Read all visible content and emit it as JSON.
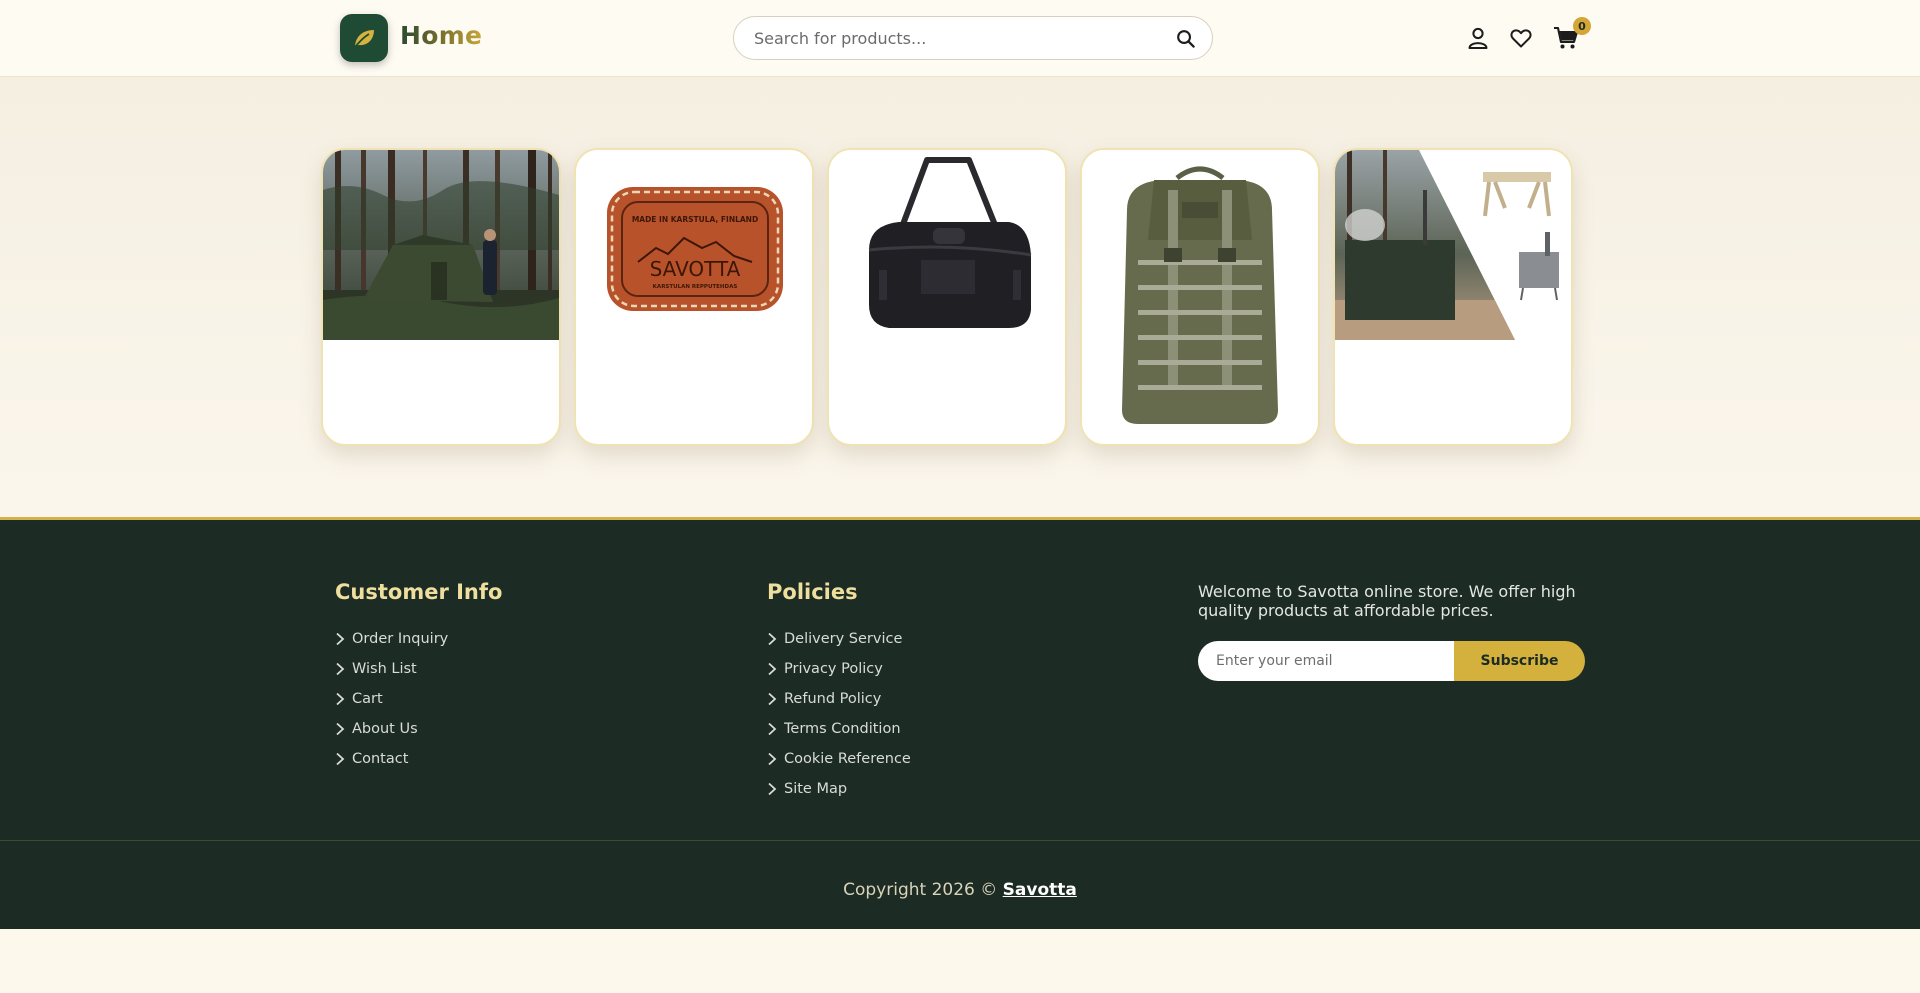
{
  "header": {
    "brand": "Home",
    "search_placeholder": "Search for products...",
    "cart_count": "0"
  },
  "products": [
    {
      "name": "tent-in-forest"
    },
    {
      "name": "savotta-leather-patch",
      "patch_line1": "MADE IN KARSTULA, FINLAND",
      "patch_brand": "SAVOTTA",
      "patch_line2": "KARSTULAN REPPUTEHDAS"
    },
    {
      "name": "black-duffel-bag"
    },
    {
      "name": "green-backpack"
    },
    {
      "name": "sauna-tent-stove-table"
    }
  ],
  "footer": {
    "customer_info": {
      "title": "Customer Info",
      "links": [
        "Order Inquiry",
        "Wish List",
        "Cart",
        "About Us",
        "Contact"
      ]
    },
    "policies": {
      "title": "Policies",
      "links": [
        "Delivery Service",
        "Privacy Policy",
        "Refund Policy",
        "Terms Condition",
        "Cookie Reference",
        "Site Map"
      ]
    },
    "about_text": "Welcome to Savotta online store. We offer high quality products at affordable prices.",
    "email_placeholder": "Enter your email",
    "subscribe_label": "Subscribe",
    "copyright_prefix": "Copyright 2026 © ",
    "copyright_brand": "Savotta"
  },
  "colors": {
    "primary_green": "#1c2b24",
    "accent_gold": "#d4b03c",
    "background": "#fdf8ec"
  }
}
